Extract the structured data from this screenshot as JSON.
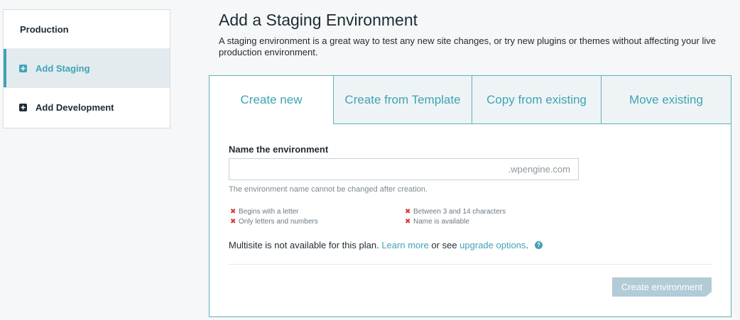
{
  "sidebar": {
    "items": [
      {
        "label": "Production"
      },
      {
        "label": "Add Staging",
        "icon": "plus-square-icon",
        "active": true
      },
      {
        "label": "Add Development",
        "icon": "plus-square-icon"
      }
    ]
  },
  "header": {
    "title": "Add a Staging Environment",
    "description": "A staging environment is a great way to test any new site changes, or try new plugins or themes without affecting your live production environment."
  },
  "tabs": [
    {
      "label": "Create new",
      "active": true
    },
    {
      "label": "Create from Template"
    },
    {
      "label": "Copy from existing"
    },
    {
      "label": "Move existing"
    }
  ],
  "form": {
    "field_label": "Name the environment",
    "input_value": "",
    "suffix": ".wpengine.com",
    "hint": "The environment name cannot be changed after creation.",
    "rules": [
      "Begins with a letter",
      "Only letters and numbers",
      "Between 3 and 14 characters",
      "Name is available"
    ],
    "rule_icon": "x-icon",
    "multisite_text": "Multisite is not available for this plan. ",
    "learn_more": "Learn more",
    "or_see": " or see ",
    "upgrade_options": "upgrade options",
    "period": ".",
    "help_icon": "question-circle-icon",
    "submit_label": "Create environment"
  },
  "colors": {
    "accent": "#3fa3b5",
    "error": "#d43a3a",
    "button_disabled": "#b3cbd6"
  }
}
